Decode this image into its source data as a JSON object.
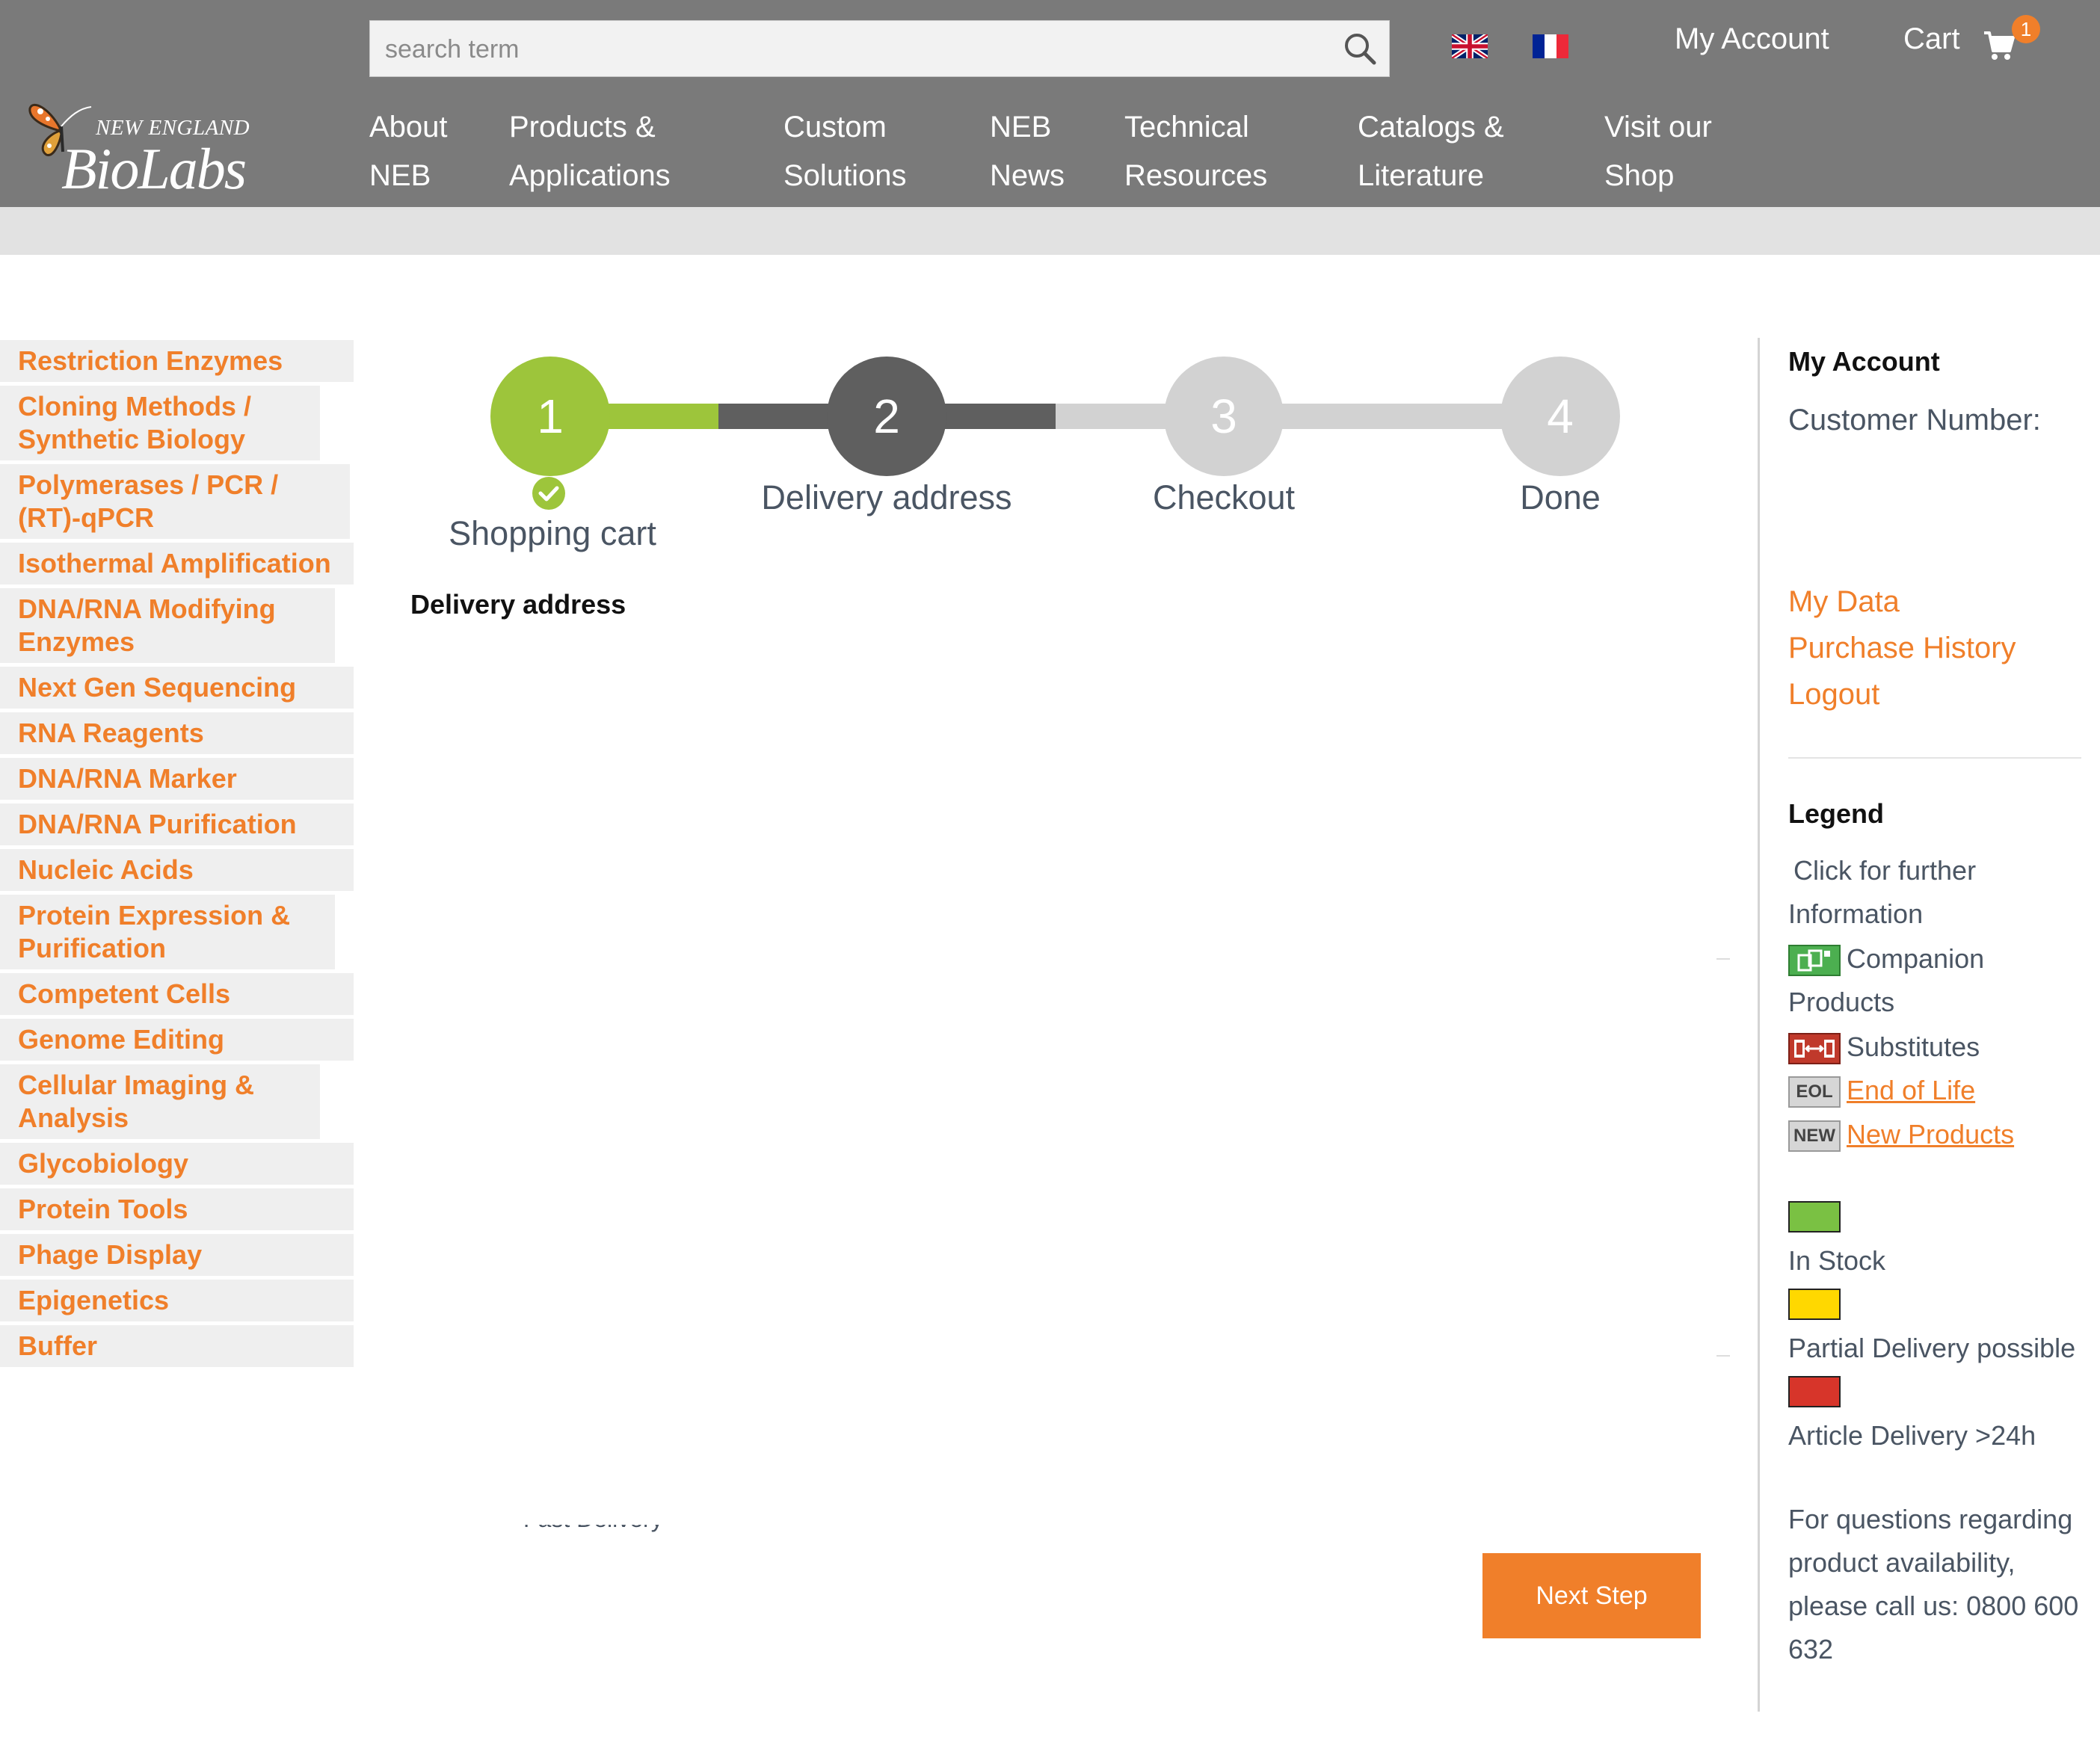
{
  "brand": {
    "line1": "NEW ENGLAND",
    "line2": "BioLabs",
    "reg": "®"
  },
  "search": {
    "placeholder": "search term"
  },
  "header": {
    "my_account": "My Account",
    "cart": "Cart",
    "cart_count": "1"
  },
  "nav": [
    {
      "line1": "About",
      "line2": "NEB"
    },
    {
      "line1": "Products &",
      "line2": "Applications"
    },
    {
      "line1": "Custom",
      "line2": "Solutions"
    },
    {
      "line1": "NEB",
      "line2": "News"
    },
    {
      "line1": "Technical",
      "line2": "Resources"
    },
    {
      "line1": "Catalogs &",
      "line2": "Literature"
    },
    {
      "line1": "Visit our",
      "line2": "Shop"
    }
  ],
  "sidebar": [
    "Restriction Enzymes",
    "Cloning Methods / Synthetic Biology",
    "Polymerases / PCR / (RT)-qPCR",
    "Isothermal Amplification",
    "DNA/RNA Modifying Enzymes",
    "Next Gen Sequencing",
    "RNA Reagents",
    "DNA/RNA Marker",
    "DNA/RNA Purification",
    "Nucleic Acids",
    "Protein Expression & Purification",
    "Competent Cells",
    "Genome Editing",
    "Cellular Imaging & Analysis",
    "Glycobiology",
    "Protein Tools",
    "Phage Display",
    "Epigenetics",
    "Buffer"
  ],
  "steps": [
    {
      "number": "1",
      "label": "Shopping cart",
      "state": "completed",
      "color": "#9dc53b"
    },
    {
      "number": "2",
      "label": "Delivery address",
      "state": "current",
      "color": "#5f5f5f"
    },
    {
      "number": "3",
      "label": "Checkout",
      "state": "upcoming",
      "color": "#d2d2d2"
    },
    {
      "number": "4",
      "label": "Done",
      "state": "upcoming",
      "color": "#d2d2d2"
    }
  ],
  "main": {
    "section_title": "Delivery address",
    "partial_text": "Fast Delivery"
  },
  "buttons": {
    "next": "Next Step"
  },
  "account": {
    "title": "My Account",
    "customer_number_label": "Customer Number:",
    "links": [
      "My Data",
      "Purchase History",
      "Logout"
    ]
  },
  "legend": {
    "title": "Legend",
    "info_line1": "Click for further",
    "info_line2": "Information",
    "companion_line1": "Companion",
    "companion_line2": "Products",
    "substitutes": "Substitutes",
    "eol_badge": "EOL",
    "eol_link": "End of Life",
    "new_badge": "NEW",
    "new_link": "New Products",
    "in_stock": "In Stock",
    "partial": "Partial Delivery possible",
    "article_delivery": "Article Delivery >24h",
    "questions": [
      "For questions regarding",
      "product availability,",
      "please call us: 0800 600",
      "632"
    ]
  },
  "colors": {
    "header_bg": "#7a7a7a",
    "accent": "#f07f2a",
    "in_stock": "#7ac143",
    "partial": "#ffd800",
    "late": "#d7352a"
  },
  "icons": [
    "search-icon",
    "uk-flag-icon",
    "france-flag-icon",
    "cart-icon",
    "check-icon",
    "companion-products-icon",
    "substitutes-icon"
  ]
}
